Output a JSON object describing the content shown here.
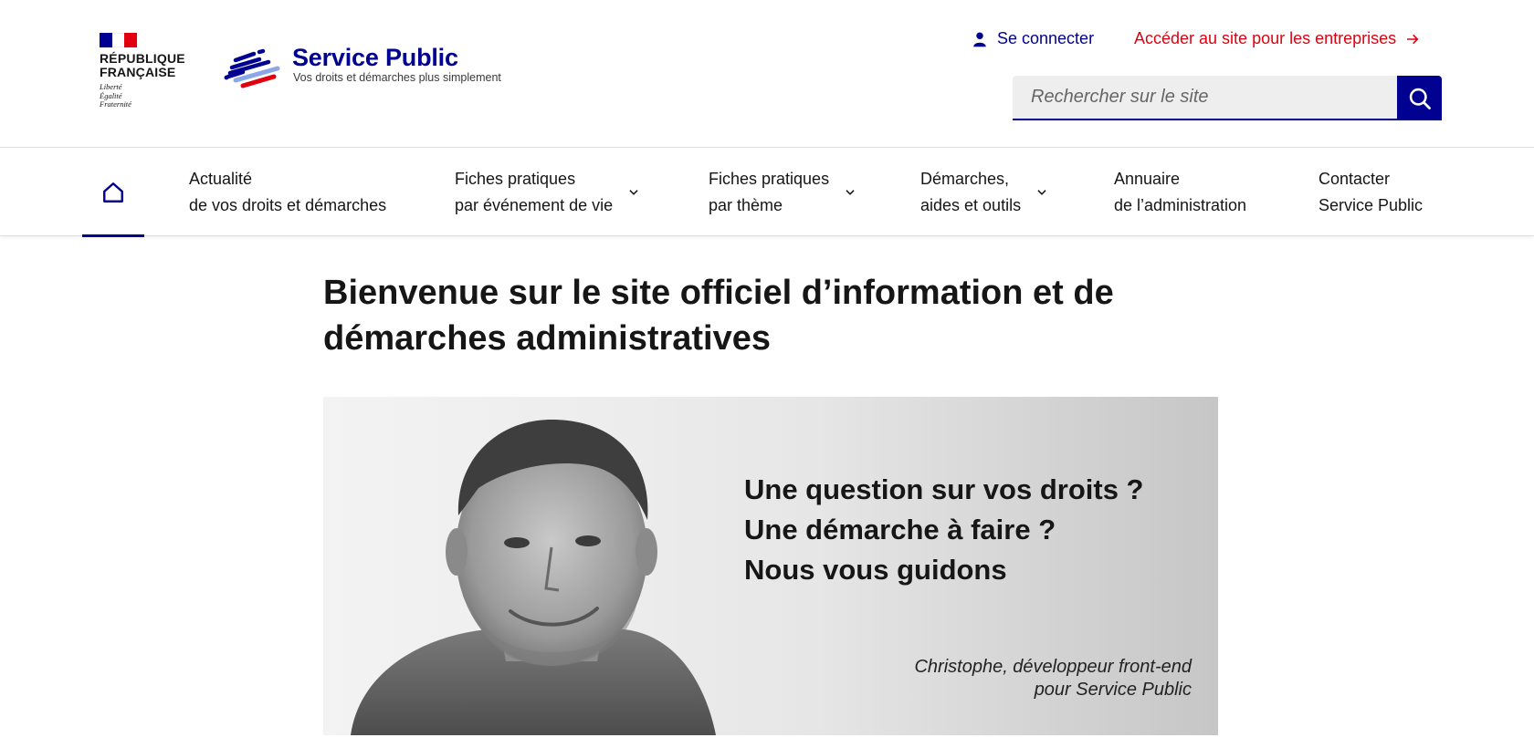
{
  "header": {
    "republique_lines": [
      "RÉPUBLIQUE",
      "FRANÇAISE"
    ],
    "devise_lines": [
      "Liberté",
      "Égalité",
      "Fraternité"
    ],
    "brand_title": "Service Public",
    "brand_subtitle": "Vos droits et démarches plus simplement",
    "login_label": "Se connecter",
    "entreprises_label": "Accéder au site pour les entreprises",
    "search_placeholder": "Rechercher sur le site"
  },
  "nav": {
    "items": [
      {
        "line1": "Actualité",
        "line2": "de vos droits et démarches",
        "dropdown": false
      },
      {
        "line1": "Fiches pratiques",
        "line2": "par événement de vie",
        "dropdown": true
      },
      {
        "line1": "Fiches pratiques",
        "line2": "par thème",
        "dropdown": true
      },
      {
        "line1": "Démarches,",
        "line2": "aides et outils",
        "dropdown": true
      },
      {
        "line1": "Annuaire",
        "line2": "de l’administration",
        "dropdown": false
      },
      {
        "line1": "Contacter",
        "line2": "Service Public",
        "dropdown": false
      }
    ]
  },
  "main": {
    "title": "Bienvenue sur le site officiel d’information et de démarches administratives",
    "hero": {
      "question_lines": [
        "Une question sur vos droits ?",
        "Une démarche à faire ?",
        "Nous vous guidons"
      ],
      "credit_lines": [
        "Christophe, développeur front-end",
        "pour Service Public"
      ]
    }
  },
  "colors": {
    "brand_blue": "#000091",
    "marianne_red": "#e1000f",
    "text": "#161616"
  },
  "icons": [
    "home-icon",
    "user-icon",
    "arrow-right-icon",
    "search-icon",
    "chevron-down-icon"
  ]
}
